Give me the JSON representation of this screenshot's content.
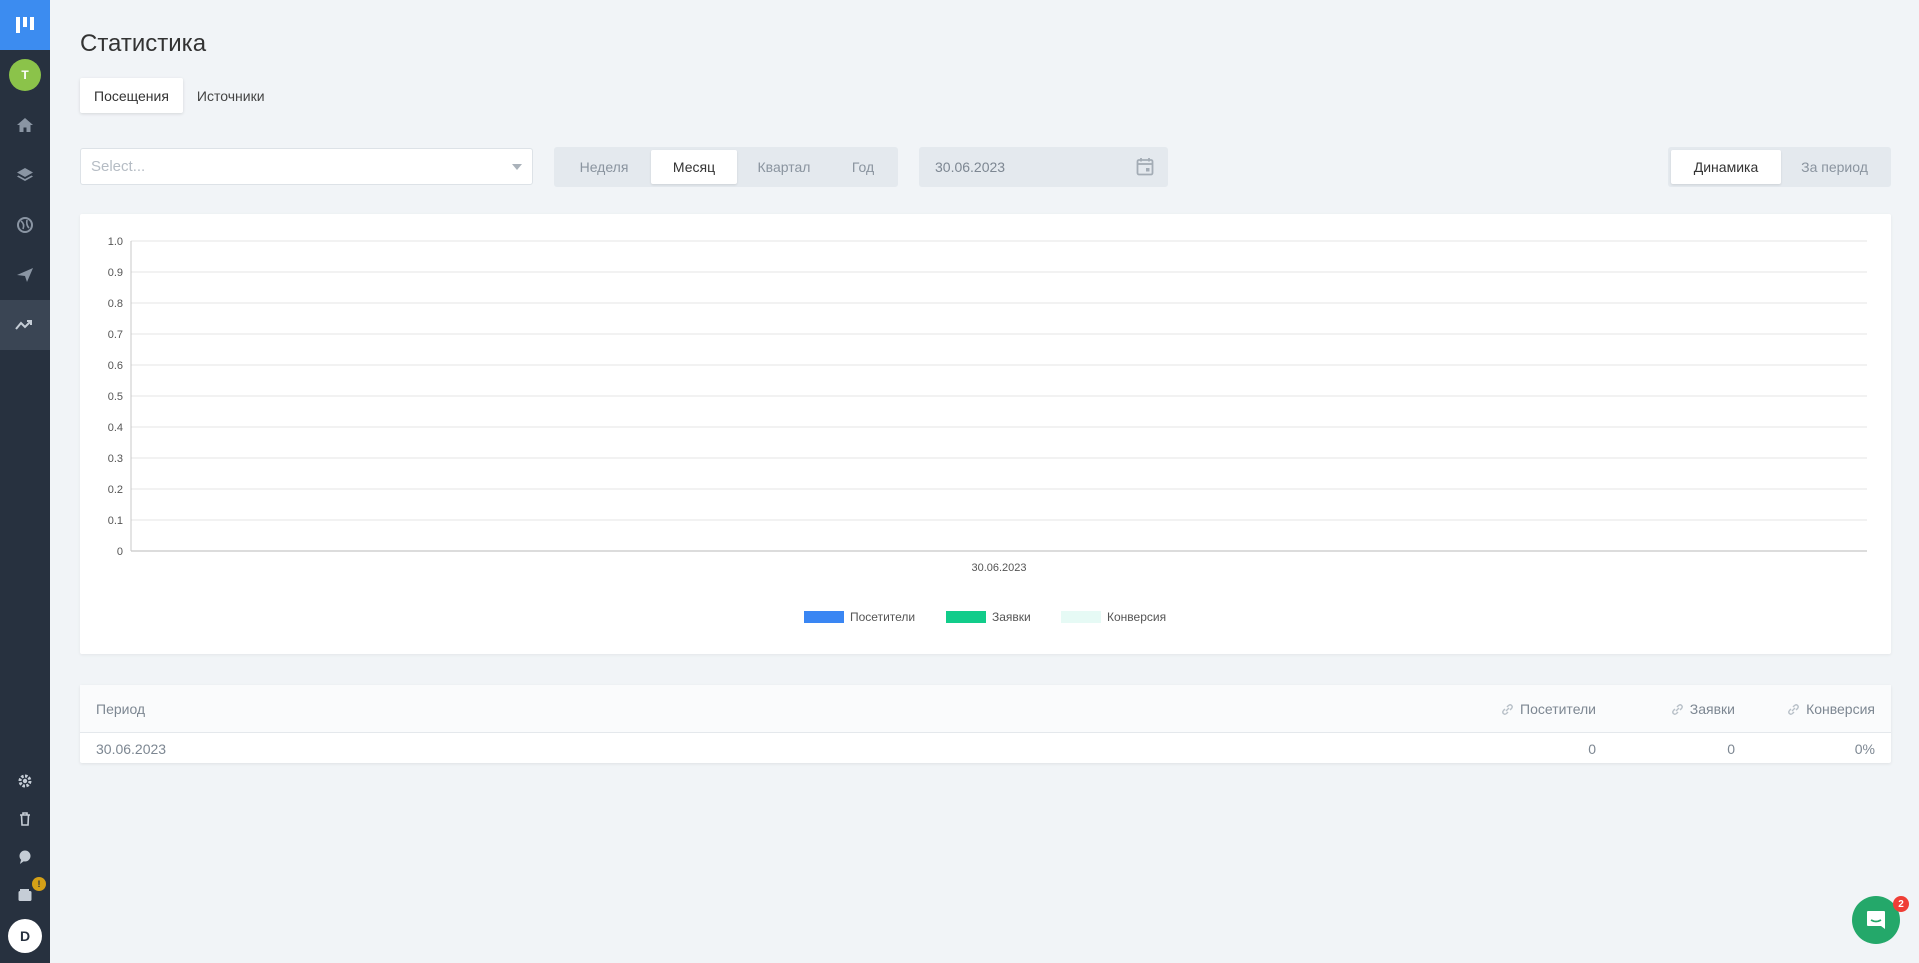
{
  "sidebar": {
    "avatar_letter": "T",
    "user_letter": "D",
    "notice_badge": "!",
    "nav_icons": [
      "home-icon",
      "layers-icon",
      "globe-icon",
      "send-icon",
      "analytics-icon"
    ],
    "bottom_icons": [
      "gear-icon",
      "trash-icon",
      "chat-bubble-icon",
      "wallet-icon"
    ]
  },
  "header": {
    "title": "Статистика",
    "tabs": [
      "Посещения",
      "Источники"
    ]
  },
  "filters": {
    "select_placeholder": "Select...",
    "period_options": [
      "Неделя",
      "Месяц",
      "Квартал",
      "Год"
    ],
    "period_selected": "Месяц",
    "date_value": "30.06.2023",
    "mode_options": [
      "Динамика",
      "За период"
    ],
    "mode_selected": "Динамика"
  },
  "chart_data": {
    "type": "bar",
    "categories": [
      "30.06.2023"
    ],
    "series": [
      {
        "name": "Посетители",
        "values": [
          0
        ],
        "color": "#3a86f3"
      },
      {
        "name": "Заявки",
        "values": [
          0
        ],
        "color": "#11cc8a"
      },
      {
        "name": "Конверсия",
        "values": [
          0
        ],
        "color": "#e6faf5"
      }
    ],
    "ylim": [
      0,
      1.0
    ],
    "yticks": [
      "0",
      "0.1",
      "0.2",
      "0.3",
      "0.4",
      "0.5",
      "0.6",
      "0.7",
      "0.8",
      "0.9",
      "1.0"
    ],
    "grid": true,
    "legend": "bottom-center"
  },
  "table": {
    "columns": [
      "Период",
      "Посетители",
      "Заявки",
      "Конверсия"
    ],
    "rows": [
      {
        "period": "30.06.2023",
        "visitors": "0",
        "requests": "0",
        "conversion": "0%"
      }
    ]
  },
  "chat": {
    "badge": "2"
  },
  "colors": {
    "sidebar": "#27313f",
    "accent": "#3c8cf0",
    "avatar": "#8bc34a",
    "chat": "#24a86a",
    "badge": "#ef3e36"
  }
}
